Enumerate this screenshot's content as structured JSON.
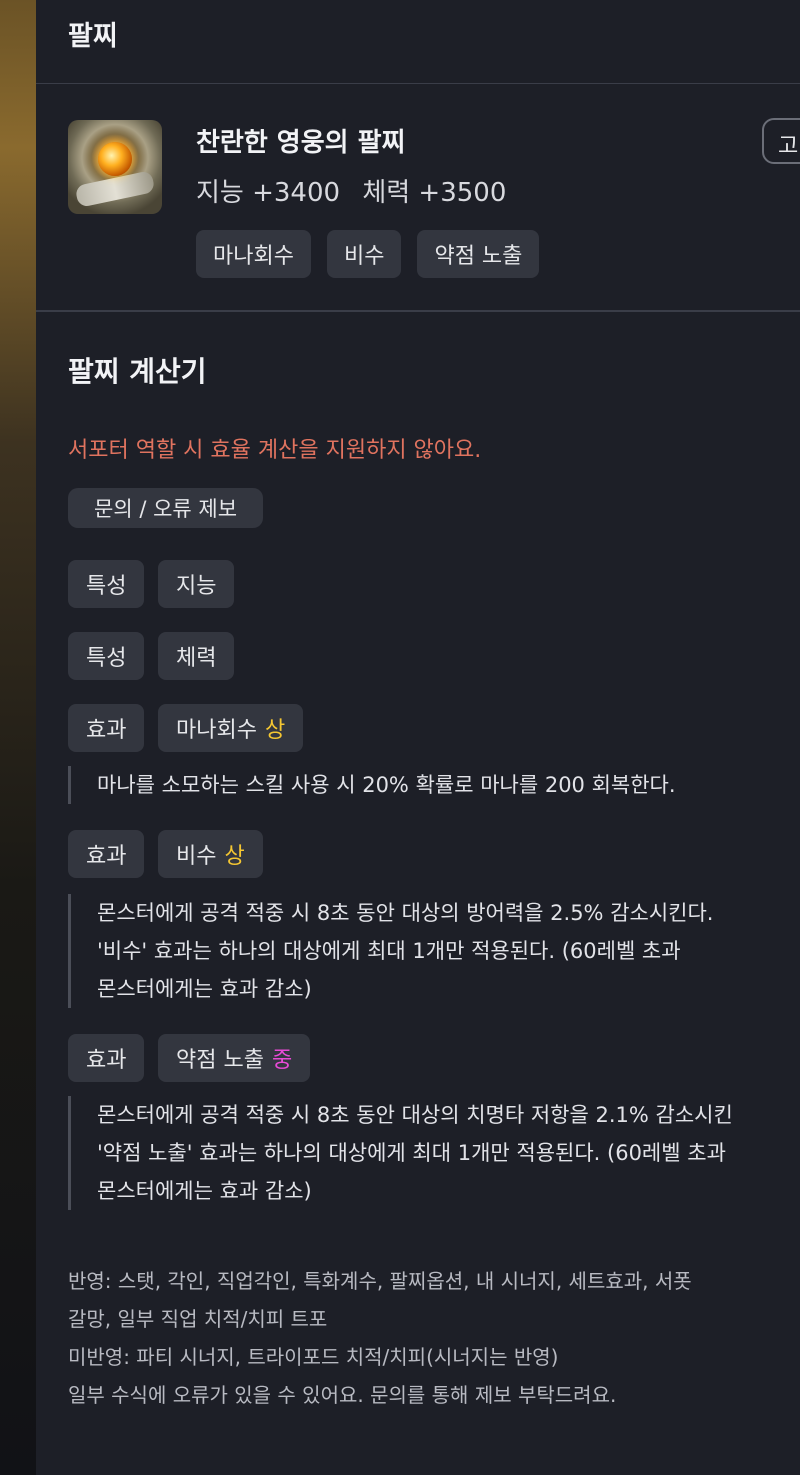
{
  "header": {
    "title": "팔찌"
  },
  "item": {
    "name": "찬란한 영웅의 팔찌",
    "stats": [
      "지능 +3400",
      "체력 +3500"
    ],
    "tags": [
      "마나회수",
      "비수",
      "약점 노출"
    ],
    "corner_button": "고"
  },
  "calculator": {
    "title": "팔찌 계산기",
    "warning": "서포터 역할 시 효율 계산을 지원하지 않아요.",
    "report_button": "문의 / 오류 제보",
    "rows": [
      {
        "label": "특성",
        "value": "지능",
        "grade": ""
      },
      {
        "label": "특성",
        "value": "체력",
        "grade": ""
      },
      {
        "label": "효과",
        "value": "마나회수",
        "grade": "상",
        "description": [
          "마나를 소모하는 스킬 사용 시 20% 확률로 마나를 200 회복한다."
        ]
      },
      {
        "label": "효과",
        "value": "비수",
        "grade": "상",
        "description": [
          "몬스터에게 공격 적중 시 8초 동안 대상의 방어력을 2.5% 감소시킨다.",
          "'비수' 효과는 하나의 대상에게 최대 1개만 적용된다. (60레벨 초과",
          "몬스터에게는 효과 감소)"
        ]
      },
      {
        "label": "효과",
        "value": "약점 노출",
        "grade": "중",
        "description": [
          "몬스터에게 공격 적중 시 8초 동안 대상의 치명타 저항을 2.1% 감소시킨",
          "'약점 노출' 효과는 하나의 대상에게 최대 1개만 적용된다. (60레벨 초과",
          "몬스터에게는 효과 감소)"
        ]
      }
    ],
    "footer": [
      "반영: 스탯, 각인, 직업각인, 특화계수, 팔찌옵션, 내 시너지, 세트효과, 서폿",
      "갈망, 일부 직업 치적/치피 트포",
      "미반영: 파티 시너지, 트라이포드 치적/치피(시너지는 반영)",
      "일부 수식에 오류가 있을 수 있어요. 문의를 통해 제보 부탁드려요."
    ]
  },
  "colors": {
    "warning": "#e0735f",
    "grade_high": "#f5c732",
    "grade_mid": "#e84ad6"
  }
}
